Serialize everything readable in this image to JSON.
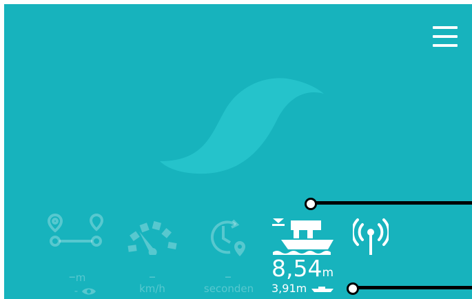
{
  "colors": {
    "background": "#17b3bd",
    "logo": "#25c3cb",
    "inactive": "rgba(255,255,255,0.28)",
    "active": "#ffffff",
    "callout": "#000000"
  },
  "menu": {
    "icon": "hamburger-menu-icon"
  },
  "stats": {
    "distance": {
      "icon": "route-pins-icon",
      "value": "–",
      "unit": "m",
      "sub_value": "-",
      "sub_icon": "eye-icon"
    },
    "speed": {
      "icon": "speedometer-icon",
      "value": "–",
      "unit": "km/h"
    },
    "time": {
      "icon": "clock-location-icon",
      "value": "–",
      "unit": "seconden"
    },
    "depth": {
      "icon": "boat-depth-icon",
      "value": "8,54",
      "unit": "m",
      "sub_value": "3,91",
      "sub_unit": "m",
      "sub_icon": "boat-length-icon"
    },
    "signal": {
      "icon": "signal-antenna-icon"
    }
  }
}
